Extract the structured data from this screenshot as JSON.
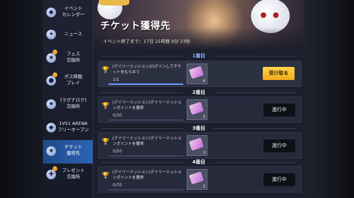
{
  "sidebar": {
    "items": [
      {
        "label": "イベント\nカレンダー",
        "icon": "calendar-icon",
        "badge": ""
      },
      {
        "label": "ニュース",
        "icon": "news-icon",
        "badge": ""
      },
      {
        "label": "フェス\n交換所",
        "icon": "fes-icon",
        "badge": "!"
      },
      {
        "label": "ボス降臨\nプレイ",
        "icon": "boss-icon",
        "badge": "!"
      },
      {
        "label": "[ラグナロク]\n交換所",
        "icon": "ragnarok-icon",
        "badge": ""
      },
      {
        "label": "1VS1 ARENA\nフリーオープン",
        "icon": "arena-icon",
        "badge": ""
      },
      {
        "label": "チケット\n獲得先",
        "icon": "ticket-icon",
        "badge": ""
      },
      {
        "label": "プレゼント\n交換所",
        "icon": "present-icon",
        "badge": "!"
      }
    ],
    "active_index": 6
  },
  "header": {
    "title": "チケット獲得先",
    "period": "イベント終了まで：17日 21時間 9分 23秒"
  },
  "missions": [
    {
      "heading": "1番目",
      "text": "[デイリーミッション]ログインしてチケットをもらおう",
      "progress": "1/1",
      "progress_ratio": 1.0,
      "reward_count": "6",
      "button": "受け取る",
      "status": "claim"
    },
    {
      "heading": "2番目",
      "text": "[デイリーミッション]デイリーミッションポイントを獲得",
      "progress": "0/30",
      "progress_ratio": 0,
      "reward_count": "3",
      "button": "進行中",
      "status": "in_progress"
    },
    {
      "heading": "3番目",
      "text": "[デイリーミッション]デイリーミッションポイントを獲得",
      "progress": "0/50",
      "progress_ratio": 0,
      "reward_count": "3",
      "button": "進行中",
      "status": "in_progress"
    },
    {
      "heading": "4番目",
      "text": "[デイリーミッション]デイリーミッションポイントを獲得",
      "progress": "0/70",
      "progress_ratio": 0,
      "reward_count": "3",
      "button": "進行中",
      "status": "in_progress"
    }
  ],
  "colors": {
    "accent": "#2b63b5",
    "claim": "#f0a81c",
    "badge": "#f0a020"
  }
}
